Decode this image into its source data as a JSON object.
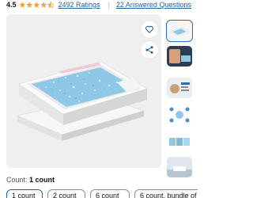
{
  "rating": {
    "value": "4.5",
    "stars": 4.5,
    "ratings_label": "2492 Ratings",
    "separator": "|",
    "questions_label": "22 Answered Questions"
  },
  "colors": {
    "star": "#f4a42a",
    "link": "#2162a1",
    "selected_border": "#2162a1",
    "image_bg": "#efefef",
    "crystals": "#8fc8e6"
  },
  "icons": {
    "heart": "heart-icon",
    "share": "share-icon"
  },
  "count": {
    "label": "Count:",
    "value": "1 count"
  },
  "options": [
    {
      "label": "1 count",
      "selected": true
    },
    {
      "label": "2 count",
      "selected": false
    },
    {
      "label": "6 count",
      "selected": false
    },
    {
      "label": "6 count, bundle of",
      "selected": false
    }
  ]
}
